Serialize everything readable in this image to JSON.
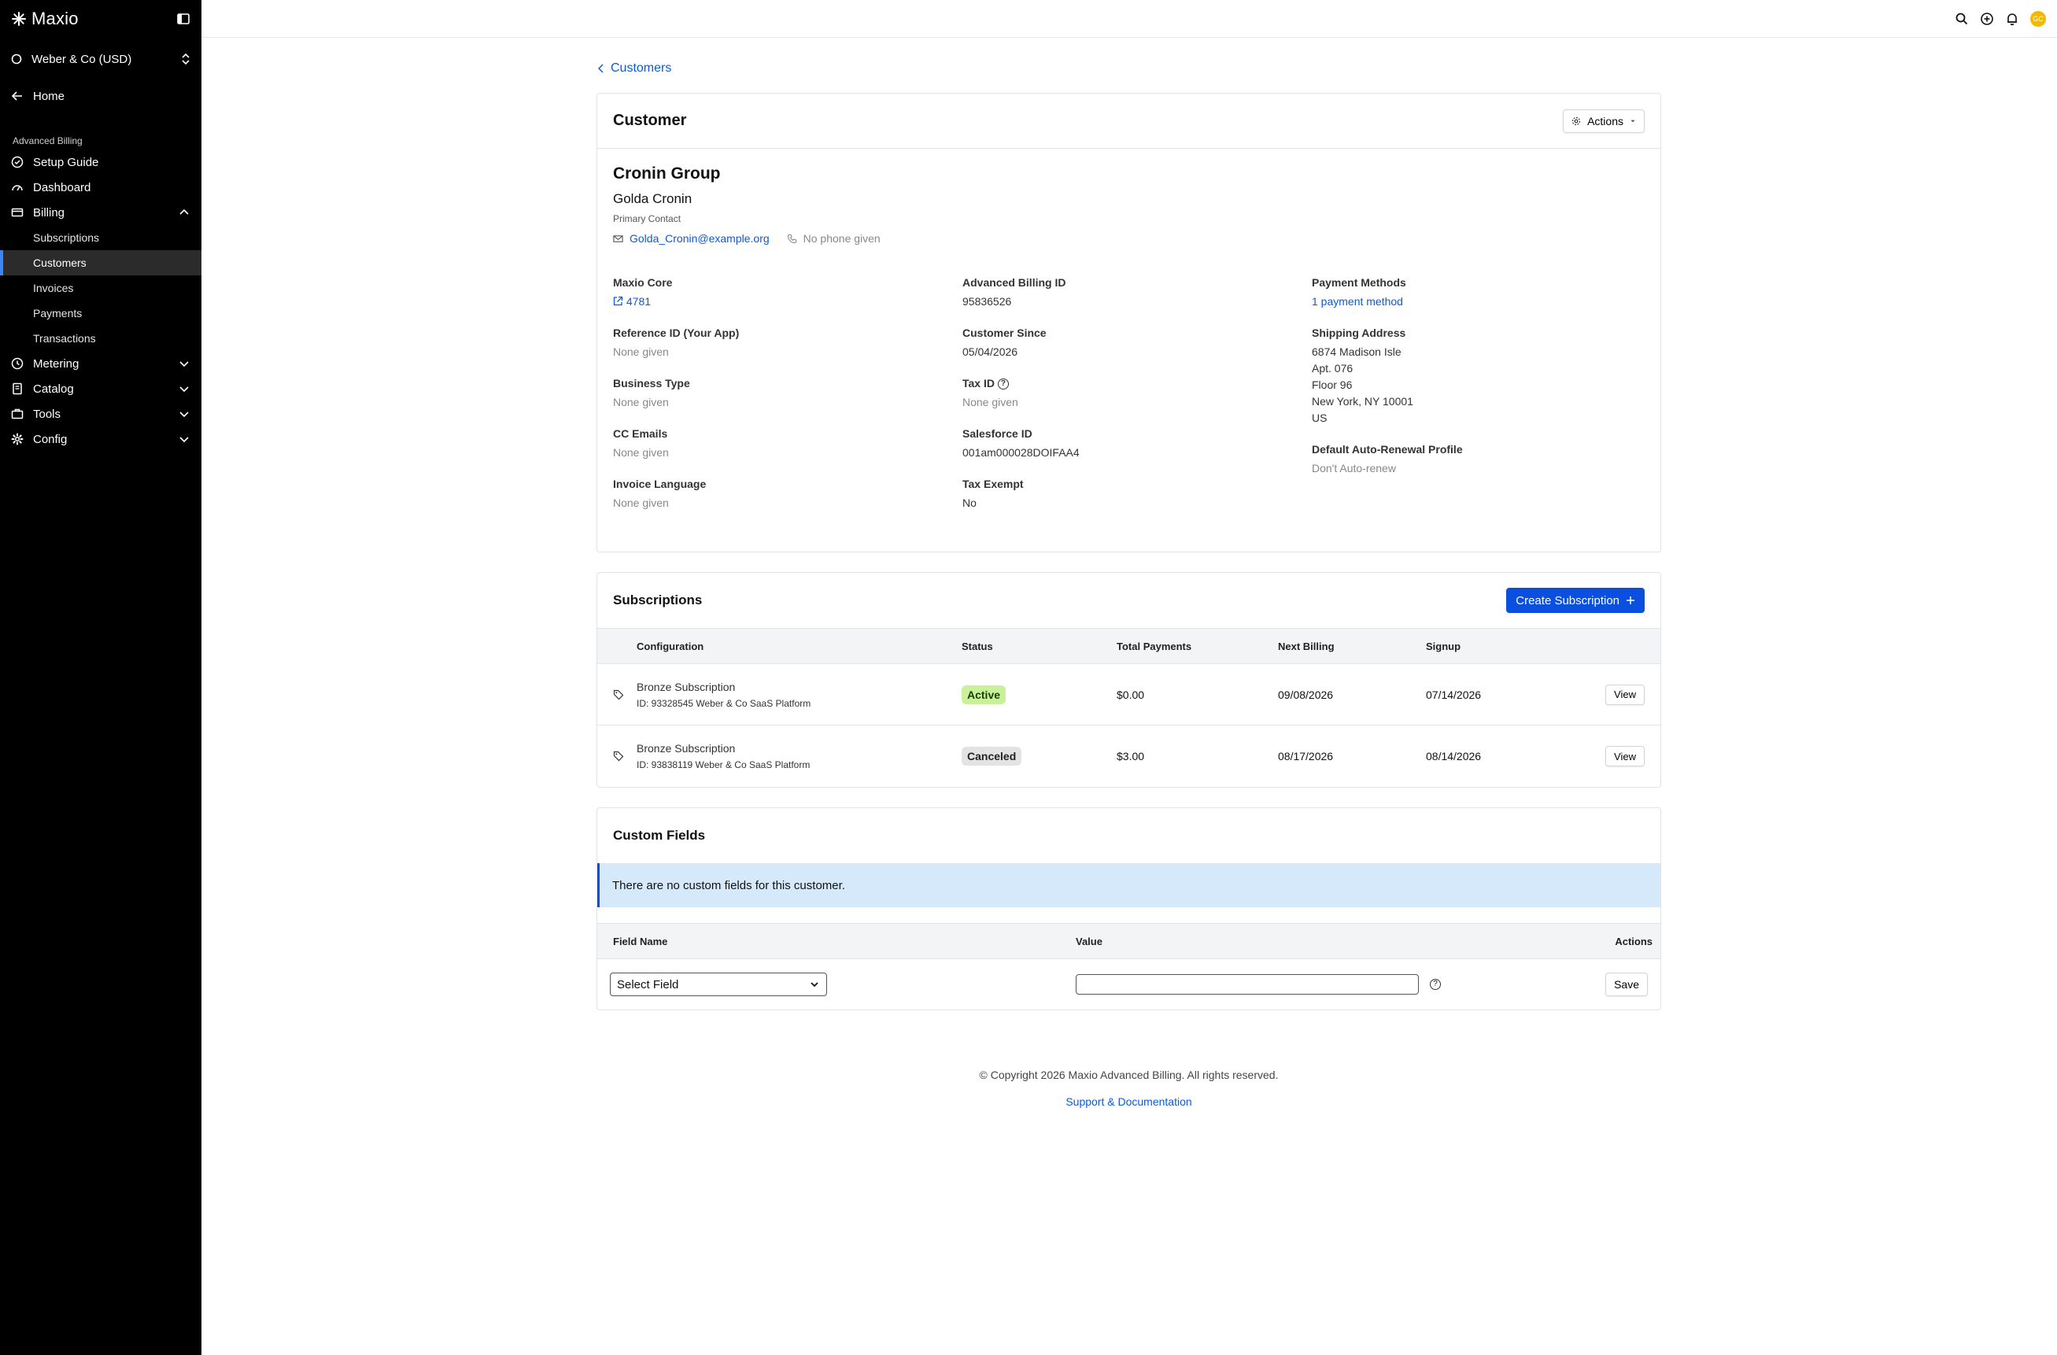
{
  "sidebar": {
    "brand": "Maxio",
    "org": "Weber & Co (USD)",
    "home": "Home",
    "section": "Advanced Billing",
    "items": {
      "setup_guide": "Setup Guide",
      "dashboard": "Dashboard",
      "billing": "Billing",
      "subscriptions": "Subscriptions",
      "customers": "Customers",
      "invoices": "Invoices",
      "payments": "Payments",
      "transactions": "Transactions",
      "metering": "Metering",
      "catalog": "Catalog",
      "tools": "Tools",
      "config": "Config"
    }
  },
  "topbar": {
    "avatar_initials": "GC"
  },
  "breadcrumb": "Customers",
  "customer_card": {
    "title": "Customer",
    "actions_label": "Actions",
    "company": "Cronin Group",
    "contact_name": "Golda Cronin",
    "contact_role": "Primary Contact",
    "email": "Golda_Cronin@example.org",
    "phone": "No phone given",
    "fields": {
      "maxio_core_label": "Maxio Core",
      "maxio_core_value": "4781",
      "reference_id_label": "Reference ID (Your App)",
      "reference_id_value": "None given",
      "business_type_label": "Business Type",
      "business_type_value": "None given",
      "cc_emails_label": "CC Emails",
      "cc_emails_value": "None given",
      "invoice_language_label": "Invoice Language",
      "invoice_language_value": "None given",
      "advanced_billing_id_label": "Advanced Billing ID",
      "advanced_billing_id_value": "95836526",
      "customer_since_label": "Customer Since",
      "customer_since_value": "05/04/2026",
      "tax_id_label": "Tax ID",
      "tax_id_value": "None given",
      "salesforce_id_label": "Salesforce ID",
      "salesforce_id_value": "001am000028DOIFAA4",
      "tax_exempt_label": "Tax Exempt",
      "tax_exempt_value": "No",
      "payment_methods_label": "Payment Methods",
      "payment_methods_value": "1 payment method",
      "shipping_address_label": "Shipping Address",
      "shipping_line1": "6874 Madison Isle",
      "shipping_line2": "Apt. 076",
      "shipping_line3": "Floor 96",
      "shipping_line4": "New York, NY 10001",
      "shipping_line5": "US",
      "auto_renewal_label": "Default Auto-Renewal Profile",
      "auto_renewal_value": "Don't Auto-renew"
    }
  },
  "subscriptions": {
    "title": "Subscriptions",
    "create_label": "Create Subscription",
    "columns": {
      "configuration": "Configuration",
      "status": "Status",
      "total_payments": "Total Payments",
      "next_billing": "Next Billing",
      "signup": "Signup"
    },
    "rows": [
      {
        "name": "Bronze Subscription",
        "meta": "ID: 93328545 Weber & Co SaaS Platform",
        "status": "Active",
        "total": "$0.00",
        "next_billing": "09/08/2026",
        "signup": "07/14/2026",
        "view": "View"
      },
      {
        "name": "Bronze Subscription",
        "meta": "ID: 93838119 Weber & Co SaaS Platform",
        "status": "Canceled",
        "total": "$3.00",
        "next_billing": "08/17/2026",
        "signup": "08/14/2026",
        "view": "View"
      }
    ]
  },
  "custom_fields": {
    "title": "Custom Fields",
    "notice": "There are no custom fields for this customer.",
    "col_field_name": "Field Name",
    "col_value": "Value",
    "col_actions": "Actions",
    "select_placeholder": "Select Field",
    "value_input": "",
    "save_label": "Save"
  },
  "footer": {
    "copyright": "© Copyright 2026 Maxio Advanced Billing. All rights reserved.",
    "support_link": "Support & Documentation"
  }
}
